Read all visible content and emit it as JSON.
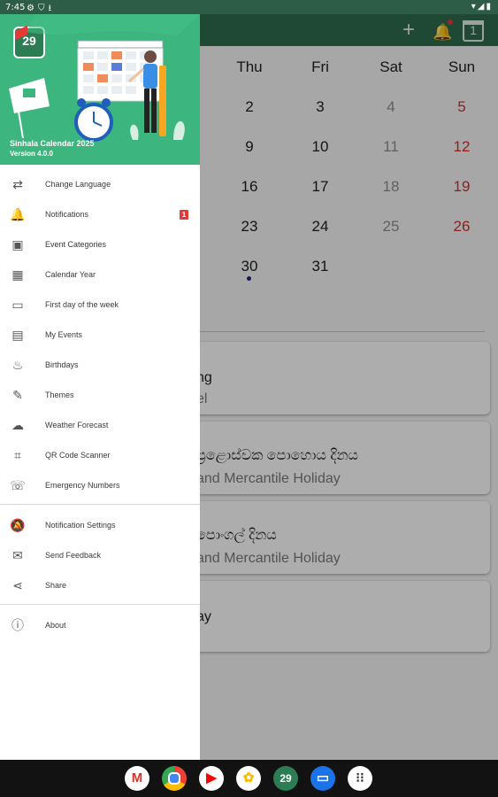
{
  "status_bar": {
    "time": "7:45",
    "left_icons": [
      "gear-icon",
      "shield-icon",
      "download-icon"
    ],
    "right_icons": [
      "wifi-icon",
      "signal-icon",
      "battery-icon"
    ]
  },
  "app_bar": {
    "actions": [
      "add-icon",
      "bell-icon",
      "calendar-today-icon"
    ],
    "today_date": "1",
    "accent": "#2f6a4e"
  },
  "calendar": {
    "weekdays": [
      "Thu",
      "Fri",
      "Sat",
      "Sun"
    ],
    "rows": [
      [
        "2",
        "3",
        "4",
        "5"
      ],
      [
        "9",
        "10",
        "11",
        "12"
      ],
      [
        "16",
        "17",
        "18",
        "19"
      ],
      [
        "23",
        "24",
        "25",
        "26"
      ],
      [
        "30",
        "31",
        "",
        ""
      ]
    ]
  },
  "events": [
    {
      "title": "ng",
      "subtitle": "el"
    },
    {
      "title": "ප්‍රළොස්වක පොහොය දිනය",
      "subtitle": "and Mercantile Holiday"
    },
    {
      "title": "පොංගල් දිනය",
      "subtitle": "and Mercantile Holiday"
    },
    {
      "title": "ay",
      "subtitle": ""
    }
  ],
  "drawer": {
    "app_name": "Sinhala Calendar 2025",
    "version": "Version 4.0.0",
    "logo_number": "29",
    "menu": [
      {
        "label": "Change Language",
        "icon": "translate-icon"
      },
      {
        "label": "Notifications",
        "icon": "bell-icon",
        "badge": "1"
      },
      {
        "label": "Event Categories",
        "icon": "event-categories-icon"
      },
      {
        "label": "Calendar Year",
        "icon": "calendar-grid-icon"
      },
      {
        "label": "First day of the week",
        "icon": "calendar-week-icon"
      },
      {
        "label": "My Events",
        "icon": "event-icon"
      },
      {
        "label": "Birthdays",
        "icon": "cake-icon"
      },
      {
        "label": "Themes",
        "icon": "palette-icon"
      },
      {
        "label": "Weather Forecast",
        "icon": "weather-icon"
      },
      {
        "label": "QR Code Scanner",
        "icon": "qr-scanner-icon"
      },
      {
        "label": "Emergency Numbers",
        "icon": "phone-icon"
      }
    ],
    "menu2": [
      {
        "label": "Notification Settings",
        "icon": "bell-off-icon"
      },
      {
        "label": "Send Feedback",
        "icon": "feedback-icon"
      },
      {
        "label": "Share",
        "icon": "share-icon"
      }
    ],
    "menu3": [
      {
        "label": "About",
        "icon": "info-icon"
      }
    ]
  },
  "dock": [
    "gmail-icon",
    "chrome-icon",
    "youtube-icon",
    "photos-icon",
    "calendar-app-icon",
    "messages-icon",
    "app-drawer-icon"
  ]
}
